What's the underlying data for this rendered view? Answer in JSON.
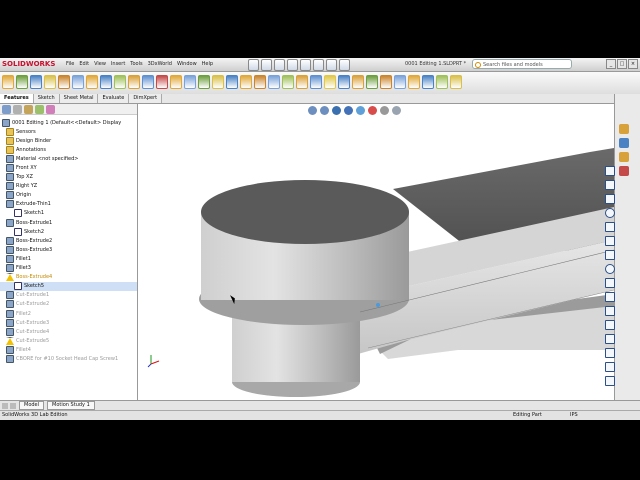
{
  "window": {
    "app_logo": "SOLIDWORKS",
    "document_title": "0001 Editing 1.SLDPRT *",
    "search_placeholder": "Search files and models",
    "window_buttons": [
      "_",
      "□",
      "×"
    ]
  },
  "menu": [
    "File",
    "Edit",
    "View",
    "Insert",
    "Tools",
    "3DxWorld",
    "Window",
    "Help"
  ],
  "command_tabs": [
    {
      "label": "Features",
      "active": true
    },
    {
      "label": "Sketch",
      "active": false
    },
    {
      "label": "Sheet Metal",
      "active": false
    },
    {
      "label": "Evaluate",
      "active": false
    },
    {
      "label": "DimXpert",
      "active": false
    }
  ],
  "feature_tree": {
    "items": [
      {
        "label": "0001 Editing 1 (Default<<Default> Display",
        "icon": "part-icon",
        "state": "normal"
      },
      {
        "label": "Sensors",
        "icon": "folder-icon",
        "state": "normal"
      },
      {
        "label": "Design Binder",
        "icon": "folder-icon",
        "state": "normal"
      },
      {
        "label": "Annotations",
        "icon": "folder-icon",
        "state": "normal"
      },
      {
        "label": "Material <not specified>",
        "icon": "material-icon",
        "state": "normal"
      },
      {
        "label": "Front XY",
        "icon": "plane-icon",
        "state": "normal"
      },
      {
        "label": "Top XZ",
        "icon": "plane-icon",
        "state": "normal"
      },
      {
        "label": "Right YZ",
        "icon": "plane-icon",
        "state": "normal"
      },
      {
        "label": "Origin",
        "icon": "origin-icon",
        "state": "normal"
      },
      {
        "label": "Extrude-Thin1",
        "icon": "extrude-icon",
        "state": "normal"
      },
      {
        "label": "Sketch1",
        "icon": "sketch-icon",
        "state": "normal",
        "indent": 2
      },
      {
        "label": "Boss-Extrude1",
        "icon": "extrude-icon",
        "state": "normal"
      },
      {
        "label": "Sketch2",
        "icon": "sketch-icon",
        "state": "normal",
        "indent": 2
      },
      {
        "label": "Boss-Extrude2",
        "icon": "extrude-icon",
        "state": "normal"
      },
      {
        "label": "Boss-Extrude3",
        "icon": "extrude-icon",
        "state": "normal"
      },
      {
        "label": "Fillet1",
        "icon": "fillet-icon",
        "state": "normal"
      },
      {
        "label": "Fillet3",
        "icon": "fillet-icon",
        "state": "normal"
      },
      {
        "label": "Boss-Extrude4",
        "icon": "warning-icon",
        "state": "selected"
      },
      {
        "label": "Sketch5",
        "icon": "sketch-icon",
        "state": "highlighted",
        "indent": 2
      },
      {
        "label": "Cut-Extrude1",
        "icon": "cut-icon",
        "state": "dim"
      },
      {
        "label": "Cut-Extrude2",
        "icon": "cut-icon",
        "state": "dim"
      },
      {
        "label": "Fillet2",
        "icon": "fillet-icon",
        "state": "dim"
      },
      {
        "label": "Cut-Extrude3",
        "icon": "cut-icon",
        "state": "dim"
      },
      {
        "label": "Cut-Extrude4",
        "icon": "cut-icon",
        "state": "dim"
      },
      {
        "label": "Cut-Extrude5",
        "icon": "warning-icon",
        "state": "dim"
      },
      {
        "label": "Fillet4",
        "icon": "fillet-icon",
        "state": "dim"
      },
      {
        "label": "CBORE for #10 Socket Head Cap Screw1",
        "icon": "hole-icon",
        "state": "dim"
      }
    ]
  },
  "bottom_tabs": [
    {
      "label": "Model",
      "active": true
    },
    {
      "label": "Motion Study 1",
      "active": false
    }
  ],
  "status": {
    "left": "SolidWorks 3D Lab Edition",
    "mode": "Editing Part",
    "units": "IPS"
  },
  "colors": {
    "accent": "#c8102e",
    "selection": "#cfe0f6",
    "warning": "#f2c200",
    "model_light": "#dcdcdc",
    "model_dark": "#5a5a5a"
  }
}
